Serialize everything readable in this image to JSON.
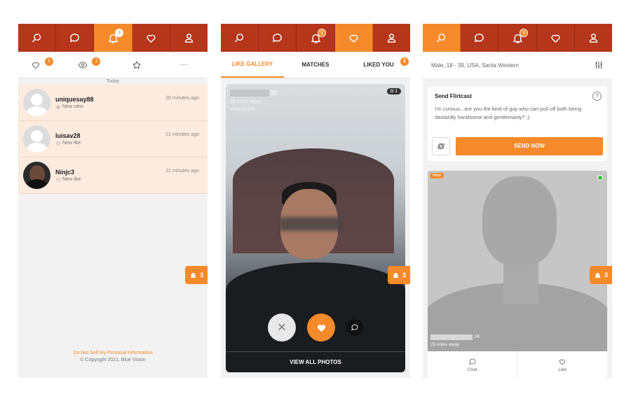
{
  "colors": {
    "nav": "#b5361b",
    "accent": "#f58a2a",
    "rowbg": "#fdebdf"
  },
  "nav_icons": [
    "search-icon",
    "chat-icon",
    "bell-icon",
    "heart-icon",
    "user-icon"
  ],
  "screen1": {
    "nav_badge": "3",
    "subtabs": {
      "likes_badge": "2",
      "views_badge": "1",
      "more": "···"
    },
    "day_label": "Today",
    "items": [
      {
        "name": "uniquesay88",
        "status": "New view",
        "time": "20 minutes ago"
      },
      {
        "name": "luisav28",
        "status": "New like",
        "time": "21 minutes ago"
      },
      {
        "name": "Ninjc3",
        "status": "New like",
        "time": "21 minutes ago"
      }
    ],
    "footer_link": "Do Not Sell My Personal Information",
    "copyright": "© Copyright 2021, Blue Vision",
    "bell_count": "3"
  },
  "screen2": {
    "nav_badge": "3",
    "tabs": [
      "LIKE GALLERY",
      "MATCHES",
      "LIKED YOU"
    ],
    "liked_badge": "2",
    "age": "30",
    "distance": "50 miles away",
    "view_profile": "View profile ›",
    "photo_count": "1",
    "dismiss_symbol": "✕",
    "view_all": "VIEW ALL PHOTOS",
    "bell_count": "3"
  },
  "screen3": {
    "nav_badge": "3",
    "filter": "Male, 18 - 39, USA, Santa Western",
    "flirt_title": "Send Flirtcast",
    "help": "?",
    "flirt_msg": "I'm curious...are you the kind of guy who can pull off both being dastardly handsome and gentlemanly? ;)",
    "send": "SEND NOW",
    "new_label": "New",
    "age": "24",
    "distance": "25 miles away",
    "chat": "Chat",
    "like": "Like",
    "bell_count": "3"
  }
}
